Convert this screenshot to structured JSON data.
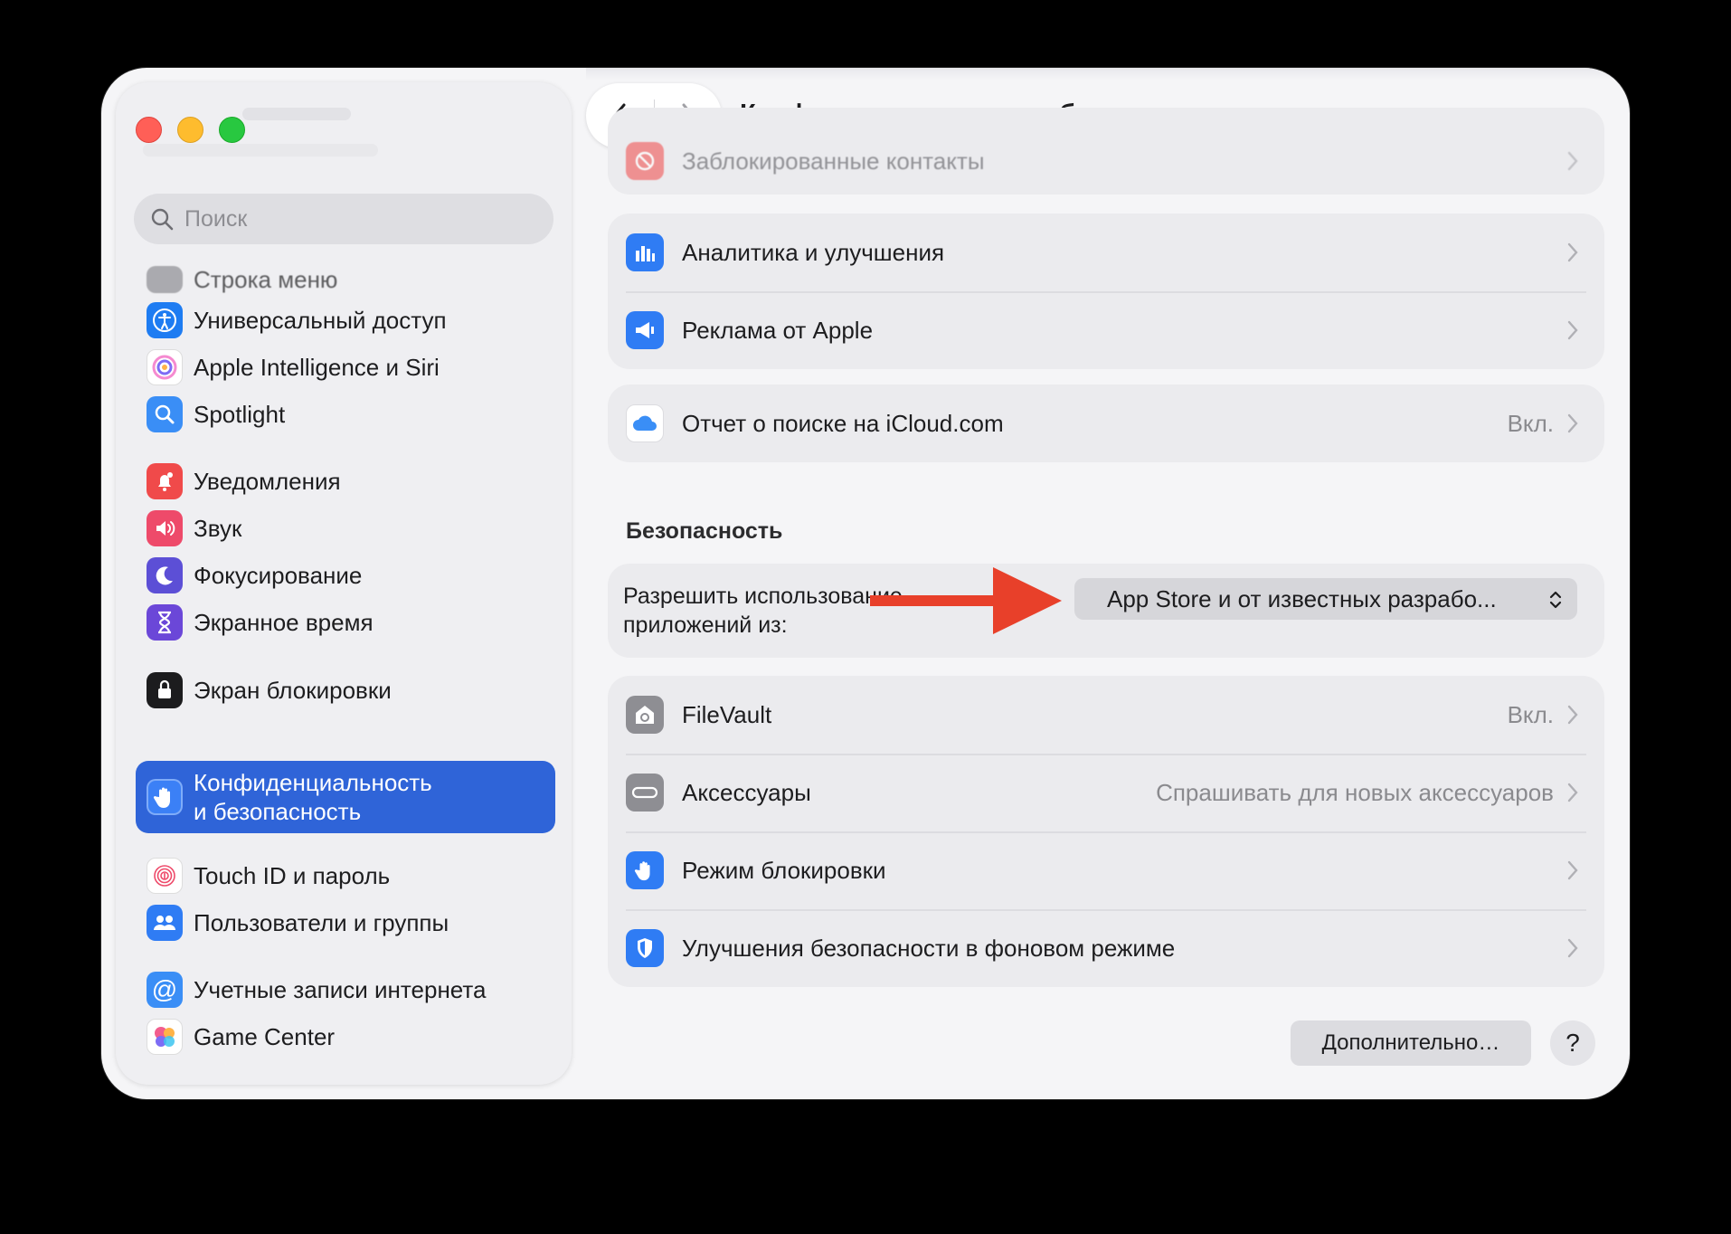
{
  "window": {
    "title": "Конфиденциальность и безопасность"
  },
  "sidebar": {
    "search_placeholder": "Поиск",
    "partial_top_item": "Строка меню",
    "items": [
      {
        "label": "Универсальный доступ",
        "icon": "accessibility-icon",
        "color": "#1e7cf2"
      },
      {
        "label": "Apple Intelligence и Siri",
        "icon": "apple-intelligence-icon",
        "color": "#f58ad0"
      },
      {
        "label": "Spotlight",
        "icon": "spotlight-icon",
        "color": "#3a8ef6"
      },
      {
        "label": "Уведомления",
        "icon": "notifications-icon",
        "color": "#f04a4a"
      },
      {
        "label": "Звук",
        "icon": "sound-icon",
        "color": "#ee4a6a"
      },
      {
        "label": "Фокусирование",
        "icon": "focus-moon-icon",
        "color": "#5c4fd6"
      },
      {
        "label": "Экранное время",
        "icon": "screen-time-icon",
        "color": "#6b47d8"
      },
      {
        "label": "Экран блокировки",
        "icon": "lock-screen-icon",
        "color": "#1c1c1e"
      },
      {
        "label_line1": "Конфиденциальность",
        "label_line2": "и безопасность",
        "icon": "privacy-hand-icon",
        "color": "#3b80f6",
        "selected": true
      },
      {
        "label": "Touch ID и пароль",
        "icon": "fingerprint-icon",
        "color": "#ffffff"
      },
      {
        "label": "Пользователи и группы",
        "icon": "users-icon",
        "color": "#2f7cf4"
      },
      {
        "label": "Учетные записи интернета",
        "icon": "at-sign-icon",
        "color": "#3a8ef6"
      },
      {
        "label": "Game Center",
        "icon": "game-center-icon",
        "color": "#f25d8e"
      }
    ]
  },
  "main": {
    "blocked_contacts": {
      "label": "Заблокированные контакты"
    },
    "analytics_card": [
      {
        "label": "Аналитика и улучшения",
        "icon": "analytics-icon"
      },
      {
        "label": "Реклама от Apple",
        "icon": "advertising-icon"
      }
    ],
    "icloud_card": {
      "label": "Отчет о поиске на iCloud.com",
      "value": "Вкл.",
      "icon": "icloud-icon"
    },
    "security_section_title": "Безопасность",
    "allow_apps": {
      "label_line1": "Разрешить использование",
      "label_line2": "приложений из:",
      "selected_option": "App Store и от известных разрабо..."
    },
    "security_card": [
      {
        "label": "FileVault",
        "value": "Вкл.",
        "icon": "filevault-icon"
      },
      {
        "label": "Аксессуары",
        "value": "Спрашивать для новых аксессуаров",
        "icon": "accessory-icon"
      },
      {
        "label": "Режим блокировки",
        "value": "",
        "icon": "lockdown-hand-icon"
      },
      {
        "label": "Улучшения безопасности в фоновом режиме",
        "value": "",
        "icon": "shield-icon"
      }
    ],
    "buttons": {
      "more": "Дополнительно…",
      "help": "?"
    }
  },
  "colors": {
    "accent": "#2f64d8",
    "annotation_arrow": "#e8402a"
  }
}
